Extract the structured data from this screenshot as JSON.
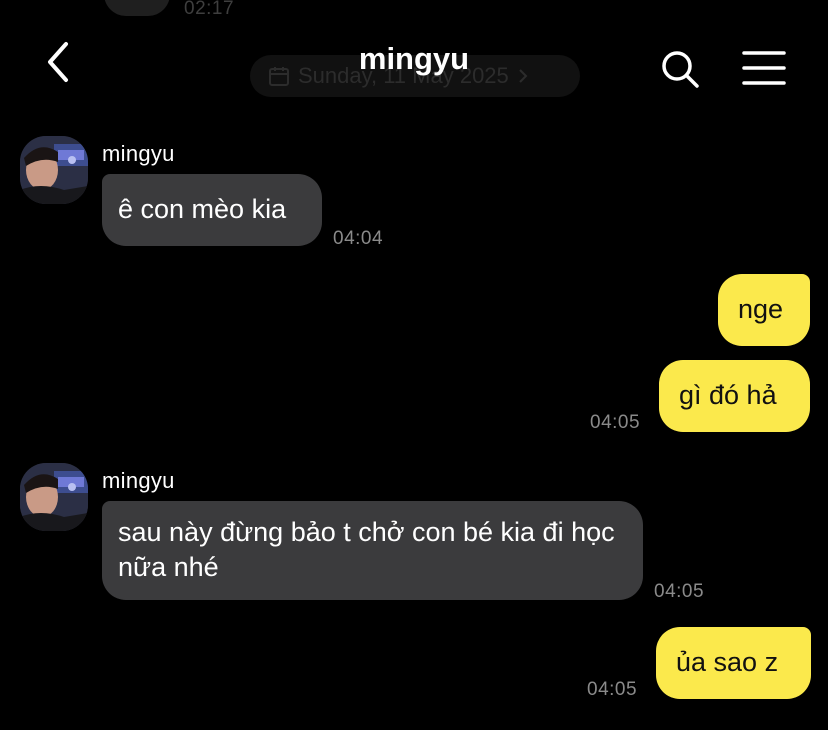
{
  "header": {
    "title": "mingyu"
  },
  "top_partial": {
    "time": "02:17"
  },
  "date_banner": {
    "text": "Sunday, 11 May 2025"
  },
  "messages": [
    {
      "direction": "incoming",
      "sender": "mingyu",
      "text": "ê con mèo kia",
      "time": "04:04"
    },
    {
      "direction": "outgoing",
      "text": "nge",
      "time": ""
    },
    {
      "direction": "outgoing",
      "text": "gì đó hả",
      "time": "04:05"
    },
    {
      "direction": "incoming",
      "sender": "mingyu",
      "text": "sau này đừng bảo t chở con bé kia đi học nữa nhé",
      "time": "04:05"
    },
    {
      "direction": "outgoing",
      "text": "ủa sao z",
      "time": "04:05"
    }
  ],
  "icons": {
    "back": "chevron-left-icon",
    "search": "search-icon",
    "menu": "hamburger-menu-icon",
    "date": "calendar-icon"
  },
  "colors": {
    "background": "#000000",
    "incoming_bubble": "#3b3b3d",
    "outgoing_bubble": "#fbe94c",
    "timestamp": "#8a8a8a"
  }
}
